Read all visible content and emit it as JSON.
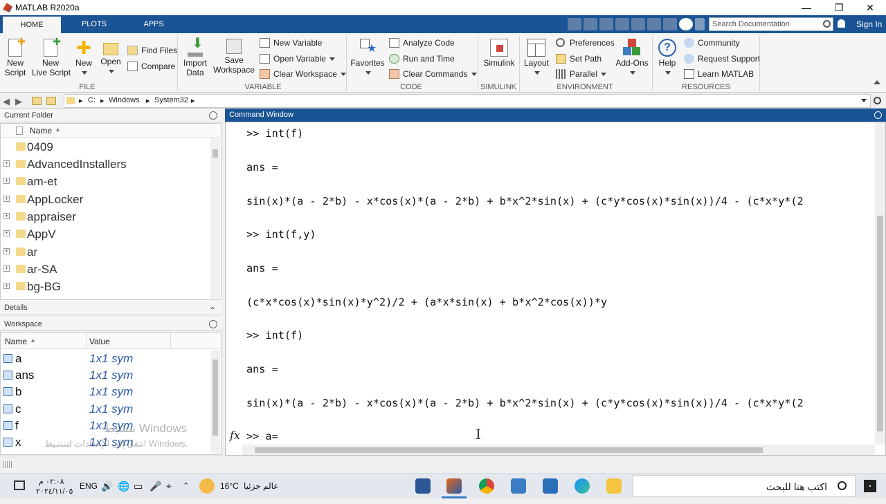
{
  "window": {
    "title": "MATLAB R2020a"
  },
  "tabs": [
    "HOME",
    "PLOTS",
    "APPS"
  ],
  "search": {
    "placeholder": "Search Documentation"
  },
  "signin": "Sign In",
  "ribbon": {
    "new_script": "New\nScript",
    "new_live_script": "New\nLive Script",
    "new": "New",
    "open": "Open",
    "find_files": "Find Files",
    "compare": "Compare",
    "import_data": "Import\nData",
    "save_workspace": "Save\nWorkspace",
    "new_variable": "New Variable",
    "open_variable": "Open Variable",
    "clear_workspace": "Clear Workspace",
    "favorites": "Favorites",
    "analyze_code": "Analyze Code",
    "run_and_time": "Run and Time",
    "clear_commands": "Clear Commands",
    "simulink": "Simulink",
    "layout": "Layout",
    "preferences": "Preferences",
    "set_path": "Set Path",
    "parallel": "Parallel",
    "add_ons": "Add-Ons",
    "help": "Help",
    "community": "Community",
    "request_support": "Request Support",
    "learn_matlab": "Learn MATLAB",
    "groups": {
      "file": "FILE",
      "variable": "VARIABLE",
      "code": "CODE",
      "simulink": "SIMULINK",
      "environment": "ENVIRONMENT",
      "resources": "RESOURCES"
    }
  },
  "address": {
    "crumbs": [
      "C:",
      "Windows",
      "System32"
    ]
  },
  "current_folder": {
    "title": "Current Folder",
    "column": "Name",
    "items": [
      "0409",
      "AdvancedInstallers",
      "am-et",
      "AppLocker",
      "appraiser",
      "AppV",
      "ar",
      "ar-SA",
      "bg-BG"
    ]
  },
  "details": {
    "title": "Details"
  },
  "workspace": {
    "title": "Workspace",
    "columns": [
      "Name",
      "Value"
    ],
    "rows": [
      {
        "name": "a",
        "value": "1x1 sym"
      },
      {
        "name": "ans",
        "value": "1x1 sym"
      },
      {
        "name": "b",
        "value": "1x1 sym"
      },
      {
        "name": "c",
        "value": "1x1 sym"
      },
      {
        "name": "f",
        "value": "1x1 sym"
      },
      {
        "name": "x",
        "value": "1x1 sym"
      }
    ]
  },
  "command_window": {
    "title": "Command Window",
    "lines": [
      ">> int(f)",
      "ans =",
      "sin(x)*(a - 2*b) - x*cos(x)*(a - 2*b) + b*x^2*sin(x) + (c*y*cos(x)*sin(x))/4 - (c*x*y*(2",
      ">> int(f,y)",
      "ans =",
      "(c*x*cos(x)*sin(x)*y^2)/2 + (a*x*sin(x) + b*x^2*cos(x))*y",
      ">> int(f)",
      "ans =",
      "sin(x)*(a - 2*b) - x*cos(x)*(a - 2*b) + b*x^2*sin(x) + (c*y*cos(x)*sin(x))/4 - (c*x*y*(2"
    ],
    "prompt": ">> a=",
    "fx": "fx"
  },
  "watermark": {
    "line1": "تنشيط Windows",
    "line2": "انتقل إلى الإعدادات لتنشيط Windows."
  },
  "taskbar": {
    "time": "٠٢:٠٨ م",
    "date": "٢٠٢٤/١١/٠٥",
    "lang": "ENG",
    "weather_temp": "16°C",
    "weather_text": "عالم جزئيا",
    "search_text": "اكتب هنا للبحث"
  },
  "colors": {
    "accent": "#1a5494",
    "folder": "#f4d98a",
    "sym_value": "#2b5aa6"
  }
}
